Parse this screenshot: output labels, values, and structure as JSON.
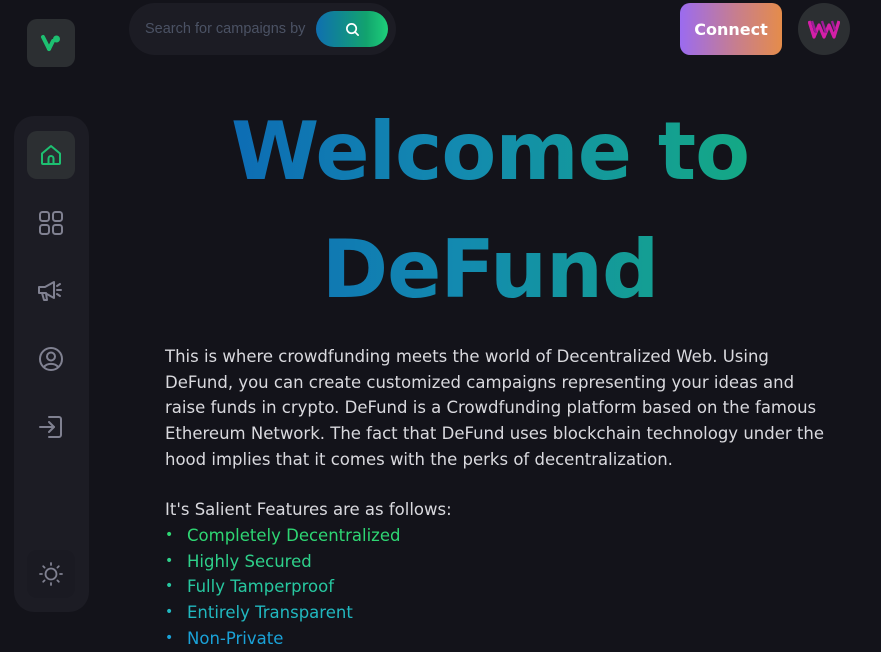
{
  "logo": {
    "icon": "brand-logo-icon",
    "color": "#1dc071"
  },
  "sidebar": {
    "items": [
      {
        "icon": "home-icon",
        "active": true
      },
      {
        "icon": "grid-icon",
        "active": false
      },
      {
        "icon": "megaphone-icon",
        "active": false
      },
      {
        "icon": "user-icon",
        "active": false
      },
      {
        "icon": "logout-icon",
        "active": false
      }
    ],
    "theme_toggle_icon": "sun-icon"
  },
  "search": {
    "placeholder": "Search for campaigns by",
    "value": "",
    "button_icon": "search-icon"
  },
  "header": {
    "connect_label": "Connect",
    "avatar_icon": "profile-logo-icon"
  },
  "hero": {
    "line1": "Welcome to",
    "line2": "DeFund"
  },
  "intro": {
    "text": "This is where crowdfunding meets the world of Decentralized Web. Using DeFund, you can create customized campaigns representing your ideas and raise funds in crypto. DeFund is a Crowdfunding platform based on the famous Ethereum Network. The fact that DeFund uses blockchain technology under the hood implies that it comes with the perks of decentralization."
  },
  "features": {
    "heading": "It's Salient Features are as follows:",
    "items": [
      {
        "label": "Completely Decentralized",
        "color": "#2ed673"
      },
      {
        "label": "Highly Secured",
        "color": "#2ed08a"
      },
      {
        "label": "Fully Tamperproof",
        "color": "#27c7a0"
      },
      {
        "label": "Entirely Transparent",
        "color": "#21b8c0"
      },
      {
        "label": "Non-Private",
        "color": "#1aa2d8"
      }
    ]
  },
  "colors": {
    "background": "#13131a",
    "panel": "#1c1c24",
    "active_item": "#2c2f32",
    "accent_green": "#1dc071"
  }
}
